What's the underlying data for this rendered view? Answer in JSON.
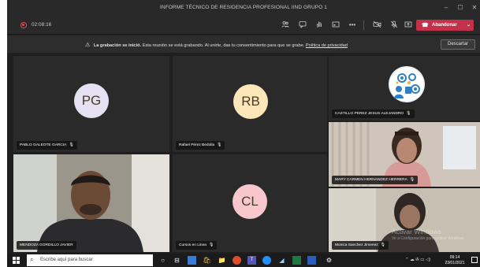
{
  "window": {
    "title": "INFORME TÉCNICO DE RESIDENCIA PROFESIONAL IIND GRUPO 1",
    "controls": {
      "minimize": "–",
      "maximize": "☐",
      "close": "✕"
    }
  },
  "toolbar": {
    "timer": "02:08:16",
    "leave_label": "Abandonar"
  },
  "banner": {
    "bold": "La grabación se inició.",
    "message": "Esta reunión se está grabando. Al unirte, das tu consentimiento para que se grabe.",
    "link": "Política de privacidad",
    "dismiss_label": "Descartar"
  },
  "participants": [
    {
      "name": "PABLO GALEOTE GARCIA",
      "initials": "PG",
      "avatar_color": "#e6e1f2"
    },
    {
      "name": "Rafael Pérez Bedolla",
      "initials": "RB",
      "avatar_color": "#fbe6b8"
    },
    {
      "name": "CASTILLO PEREZ JESUS ALEJANDRO"
    },
    {
      "name": "MARY CARMEN HERNANDEZ HERRERA"
    },
    {
      "name": "MENDOZA GORDILLO JAVIER"
    },
    {
      "name": "Cursos en Linea",
      "initials": "CL",
      "avatar_color": "#f7c7cd"
    },
    {
      "name": "Monica Sanchez Jimenez"
    }
  ],
  "watermark": {
    "line1": "Activar Windows",
    "line2": "Ve a Configuración para activar Windows."
  },
  "taskbar": {
    "search_placeholder": "Escribe aquí para buscar",
    "time": "09:14",
    "date": "23/01/2021"
  },
  "colors": {
    "leave_button": "#c4314b",
    "recording_dot": "#d9534f"
  }
}
